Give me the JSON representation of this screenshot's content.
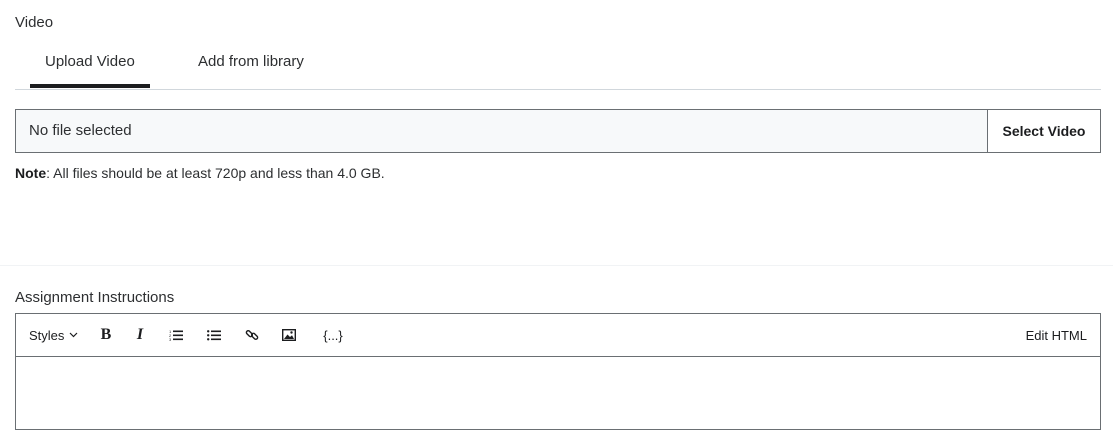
{
  "video": {
    "label": "Video",
    "tabs": [
      {
        "label": "Upload Video",
        "active": true
      },
      {
        "label": "Add from library",
        "active": false
      }
    ],
    "file": {
      "status": "No file selected",
      "button_label": "Select Video"
    },
    "note": {
      "bold": "Note",
      "text": ": All files should be at least 720p and less than 4.0 GB."
    }
  },
  "instructions": {
    "label": "Assignment Instructions",
    "toolbar": {
      "styles_label": "Styles",
      "bold_label": "B",
      "italic_label": "I",
      "code_label": "{...}",
      "edit_html_label": "Edit HTML",
      "icons": [
        "chevron-down-icon",
        "ordered-list-icon",
        "bullet-list-icon",
        "link-icon",
        "image-icon"
      ]
    },
    "content": ""
  }
}
